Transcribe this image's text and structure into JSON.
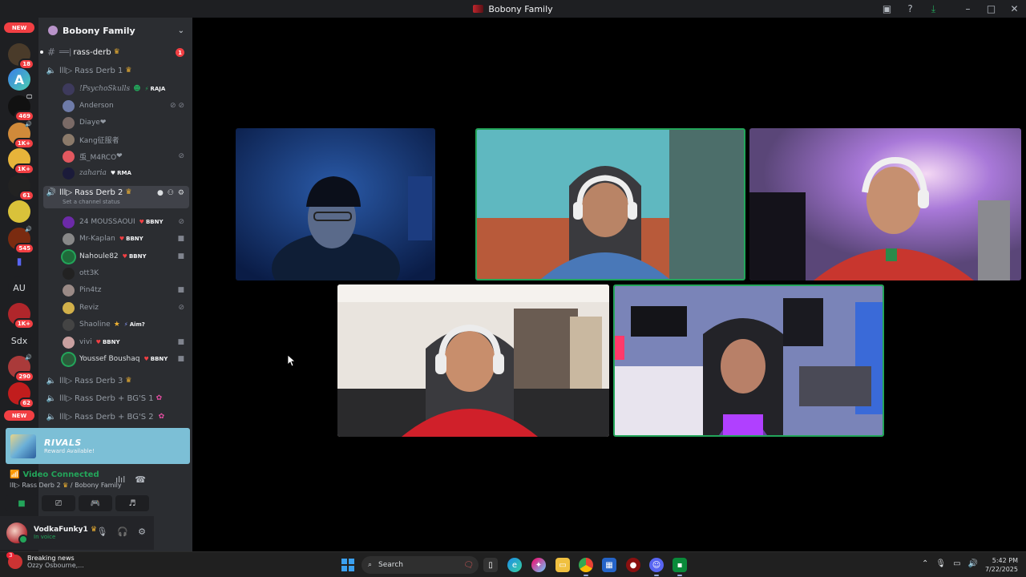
{
  "window": {
    "title": "Bobony Family"
  },
  "rail": {
    "top_pill": "NEW",
    "bottom_pill": "NEW",
    "badges": [
      "89",
      "18",
      "469",
      "1K+",
      "1K+",
      "61",
      "545",
      "1K+",
      "290",
      "62"
    ],
    "text_servers": [
      "AU",
      "Sdx"
    ]
  },
  "server": {
    "name": "Bobony Family"
  },
  "channels": {
    "text": {
      "name": "rass-derb",
      "unread": "1"
    },
    "voice1": {
      "name": "Rass Derb 1"
    },
    "voice2": {
      "name": "Rass Derb 2",
      "status": "Set a channel status"
    },
    "voice3": {
      "name": "Rass Derb 3"
    },
    "voice4": {
      "name": "Rass Derb + BG'S 1"
    },
    "voice5": {
      "name": "Rass Derb + BG'S 2"
    }
  },
  "voice1_users": [
    {
      "name": "!PsychoSkulls",
      "tag": "RAJA"
    },
    {
      "name": "Anderson",
      "tag": ""
    },
    {
      "name": "Diaye",
      "tag": ""
    },
    {
      "name": "Kang征服者",
      "tag": ""
    },
    {
      "name": "䖝_M4RCO",
      "tag": ""
    },
    {
      "name": "zaharia",
      "tag": "RMA"
    }
  ],
  "voice2_users": [
    {
      "name": "24 MOUSSAOUI",
      "tag": "BBNY"
    },
    {
      "name": "Mr-Kaplan",
      "tag": "BBNY"
    },
    {
      "name": "Nahoule82",
      "tag": "BBNY"
    },
    {
      "name": "ott3K",
      "tag": ""
    },
    {
      "name": "Pin4tz",
      "tag": ""
    },
    {
      "name": "Reviz",
      "tag": ""
    },
    {
      "name": "Shaoline",
      "tag": "Aim?"
    },
    {
      "name": "vivi",
      "tag": "BBNY"
    },
    {
      "name": "Youssef Boushaq",
      "tag": "BBNY"
    }
  ],
  "promo": {
    "game": "RIVALS",
    "text": "Reward Available!"
  },
  "voice_panel": {
    "status": "Video Connected",
    "channel": "Rass Derb 2",
    "server": "/ Bobony Family"
  },
  "user": {
    "name": "VodkaFunky1",
    "status": "In voice"
  },
  "taskbar": {
    "news_title": "Breaking news",
    "news_sub": "Ozzy Osbourne,...",
    "news_badge": "3",
    "search_placeholder": "Search",
    "time": "5:42 PM",
    "date": "7/22/2025"
  },
  "colors": {
    "speaking_border": "#23a55a",
    "accent_red": "#f23f43",
    "sidebar_bg": "#2b2d31",
    "rail_bg": "#1e1f22"
  }
}
